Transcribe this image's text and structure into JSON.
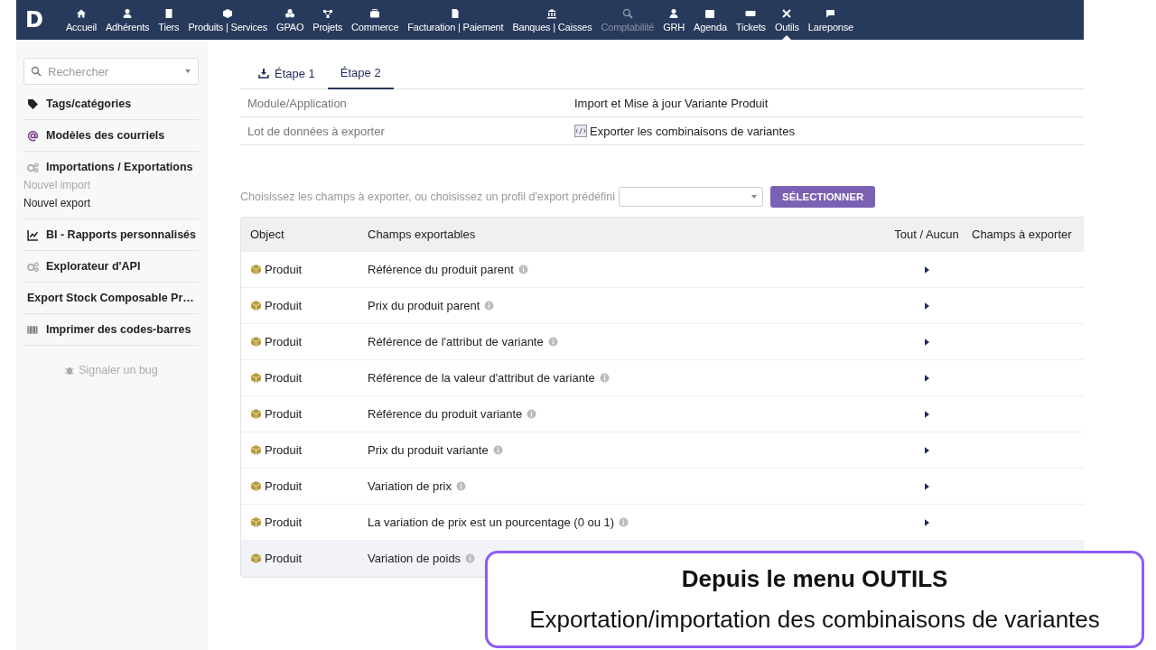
{
  "navbar": {
    "logo": "D",
    "items": [
      {
        "label": "Accueil",
        "selected": false,
        "disabled": false
      },
      {
        "label": "Adhérents",
        "selected": false,
        "disabled": false
      },
      {
        "label": "Tiers",
        "selected": false,
        "disabled": false
      },
      {
        "label": "Produits | Services",
        "selected": false,
        "disabled": false
      },
      {
        "label": "GPAO",
        "selected": false,
        "disabled": false
      },
      {
        "label": "Projets",
        "selected": false,
        "disabled": false
      },
      {
        "label": "Commerce",
        "selected": false,
        "disabled": false
      },
      {
        "label": "Facturation | Paiement",
        "selected": false,
        "disabled": false
      },
      {
        "label": "Banques | Caisses",
        "selected": false,
        "disabled": false
      },
      {
        "label": "Comptabilité",
        "selected": false,
        "disabled": true
      },
      {
        "label": "GRH",
        "selected": false,
        "disabled": false
      },
      {
        "label": "Agenda",
        "selected": false,
        "disabled": false
      },
      {
        "label": "Tickets",
        "selected": false,
        "disabled": false
      },
      {
        "label": "Outils",
        "selected": true,
        "disabled": false
      },
      {
        "label": "Lareponse",
        "selected": false,
        "disabled": false
      }
    ]
  },
  "sidebar": {
    "search": {
      "placeholder": "Rechercher"
    },
    "items": [
      {
        "label": "Tags/catégories"
      },
      {
        "label": "Modèles des courriels"
      },
      {
        "label": "Importations / Exportations",
        "children": [
          {
            "label": "Nouvel import",
            "disabled": true
          },
          {
            "label": "Nouvel export",
            "disabled": false
          }
        ]
      },
      {
        "label": "BI - Rapports personnalisés"
      },
      {
        "label": "Explorateur d'API"
      },
      {
        "label": "Export Stock Composable Pr…"
      },
      {
        "label": "Imprimer des codes-barres"
      }
    ],
    "report_bug": "Signaler un bug"
  },
  "tabs": [
    {
      "label": "Étape 1",
      "selected": false
    },
    {
      "label": "Étape 2",
      "selected": true
    }
  ],
  "info": [
    {
      "label": "Module/Application",
      "value": "Import et Mise à jour Variante Produit"
    },
    {
      "label": "Lot de données à exporter",
      "value": "Exporter les combinaisons de variantes"
    }
  ],
  "profile": {
    "label": "Choisissez les champs à exporter, ou choisissez un profil d'export prédéfini",
    "button": "SÉLECTIONNER"
  },
  "table": {
    "columns": [
      "Object",
      "Champs exportables",
      "Tout / Aucun",
      "Champs à exporter"
    ],
    "rows": [
      {
        "object": "Produit",
        "field": "Référence du produit parent",
        "selected": false
      },
      {
        "object": "Produit",
        "field": "Prix du produit parent",
        "selected": false
      },
      {
        "object": "Produit",
        "field": "Référence de l'attribut de variante",
        "selected": false
      },
      {
        "object": "Produit",
        "field": "Référence de la valeur d'attribut de variante",
        "selected": false
      },
      {
        "object": "Produit",
        "field": "Référence du produit variante",
        "selected": false
      },
      {
        "object": "Produit",
        "field": "Prix du produit variante",
        "selected": false
      },
      {
        "object": "Produit",
        "field": "Variation de prix",
        "selected": false
      },
      {
        "object": "Produit",
        "field": "La variation de prix est un pourcentage (0 ou 1)",
        "selected": false
      },
      {
        "object": "Produit",
        "field": "Variation de poids",
        "selected": true
      }
    ]
  },
  "callout": {
    "title": "Depuis le menu OUTILS",
    "text": "Exportation/importation des combinaisons de variantes"
  }
}
